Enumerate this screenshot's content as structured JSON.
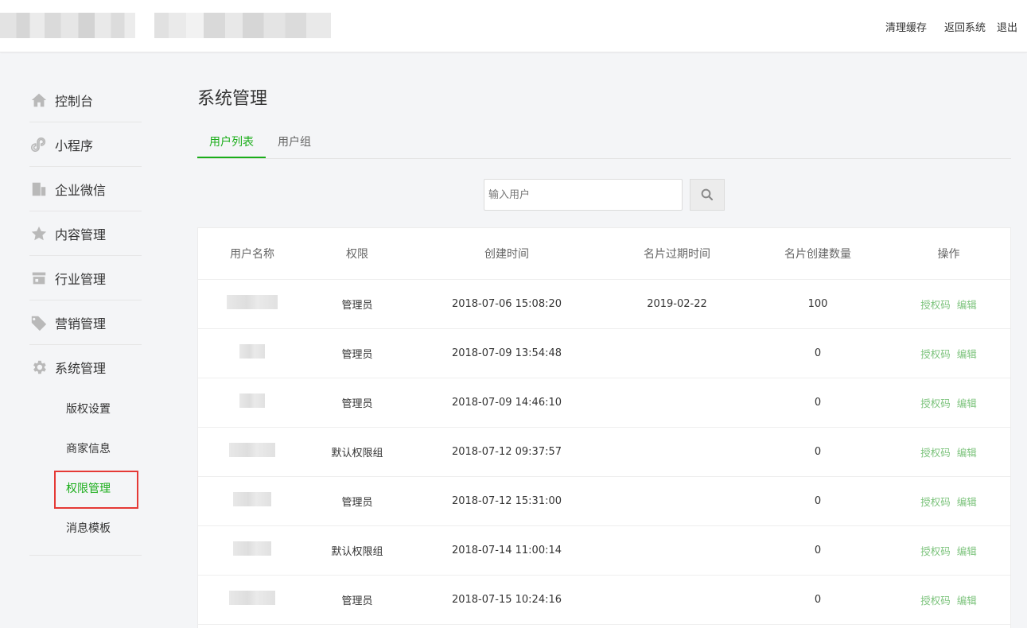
{
  "header": {
    "links": [
      "清理缓存",
      "返回系统",
      "退出"
    ]
  },
  "sidebar": {
    "items": [
      {
        "label": "控制台",
        "icon": "home-icon"
      },
      {
        "label": "小程序",
        "icon": "miniprogram-icon"
      },
      {
        "label": "企业微信",
        "icon": "building-icon"
      },
      {
        "label": "内容管理",
        "icon": "star-icon"
      },
      {
        "label": "行业管理",
        "icon": "store-icon"
      },
      {
        "label": "营销管理",
        "icon": "tag-icon"
      },
      {
        "label": "系统管理",
        "icon": "gear-icon"
      }
    ],
    "sub_items": [
      "版权设置",
      "商家信息",
      "权限管理",
      "消息模板"
    ],
    "active_sub": "权限管理"
  },
  "main": {
    "title": "系统管理",
    "tabs": [
      "用户列表",
      "用户组"
    ],
    "search": {
      "placeholder": "输入用户"
    },
    "table": {
      "headers": [
        "用户名称",
        "权限",
        "创建时间",
        "名片过期时间",
        "名片创建数量",
        "操作"
      ],
      "rows": [
        {
          "perm": "管理员",
          "created": "2018-07-06 15:08:20",
          "expires": "2019-02-22",
          "count": "100"
        },
        {
          "perm": "管理员",
          "created": "2018-07-09 13:54:48",
          "expires": "",
          "count": "0"
        },
        {
          "perm": "管理员",
          "created": "2018-07-09 14:46:10",
          "expires": "",
          "count": "0"
        },
        {
          "perm": "默认权限组",
          "created": "2018-07-12 09:37:57",
          "expires": "",
          "count": "0"
        },
        {
          "perm": "管理员",
          "created": "2018-07-12 15:31:00",
          "expires": "",
          "count": "0"
        },
        {
          "perm": "默认权限组",
          "created": "2018-07-14 11:00:14",
          "expires": "",
          "count": "0"
        },
        {
          "perm": "管理员",
          "created": "2018-07-15 10:24:16",
          "expires": "",
          "count": "0"
        }
      ],
      "ops": [
        "授权码",
        "编辑"
      ]
    }
  },
  "colors": {
    "accent": "#1aad19",
    "op_link": "#7cc37c",
    "highlight_box": "#e53935"
  }
}
